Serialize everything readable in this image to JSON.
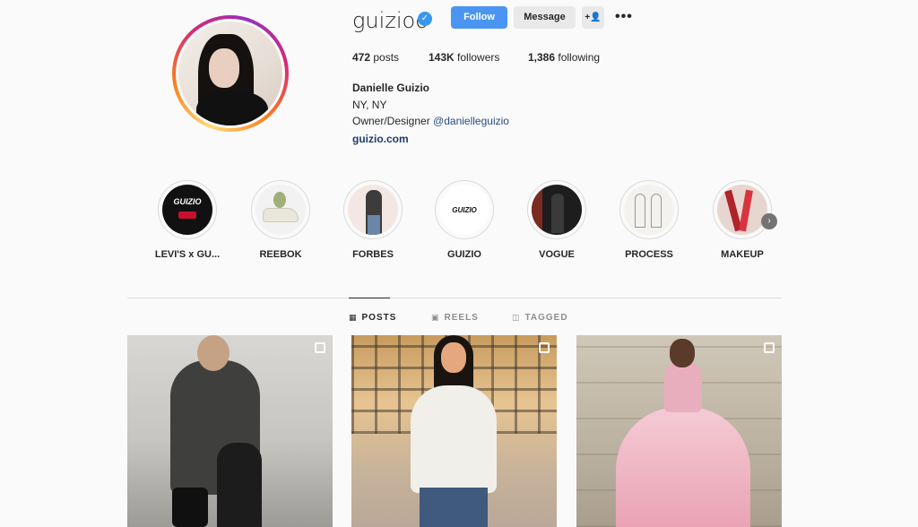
{
  "profile": {
    "username": "guizioo",
    "verified_icon": "verified-badge-icon",
    "follow_label": "Follow",
    "message_label": "Message",
    "suggest_icon": "add-person-icon",
    "more_icon": "more-options-icon",
    "more_glyph": "•••"
  },
  "stats": {
    "posts_value": "472",
    "posts_label": "posts",
    "followers_value": "143K",
    "followers_label": "followers",
    "following_value": "1,386",
    "following_label": "following"
  },
  "bio": {
    "name": "Danielle Guizio",
    "location": "NY, NY",
    "role_prefix": "Owner/Designer ",
    "mention": "@danielleguizio",
    "link": "guizio.com"
  },
  "highlights": [
    {
      "label": "LEVI'S x GU...",
      "image_text": "GUIZIO"
    },
    {
      "label": "REEBOK"
    },
    {
      "label": "FORBES"
    },
    {
      "label": "GUIZIO",
      "image_text": "GUIZIO"
    },
    {
      "label": "VOGUE"
    },
    {
      "label": "PROCESS"
    },
    {
      "label": "MAKEUP"
    }
  ],
  "tabs": {
    "posts": "POSTS",
    "reels": "REELS",
    "tagged": "TAGGED"
  },
  "colors": {
    "follow_button": "#4a95f2",
    "link": "#1f3a6b",
    "background": "#fafafa"
  }
}
